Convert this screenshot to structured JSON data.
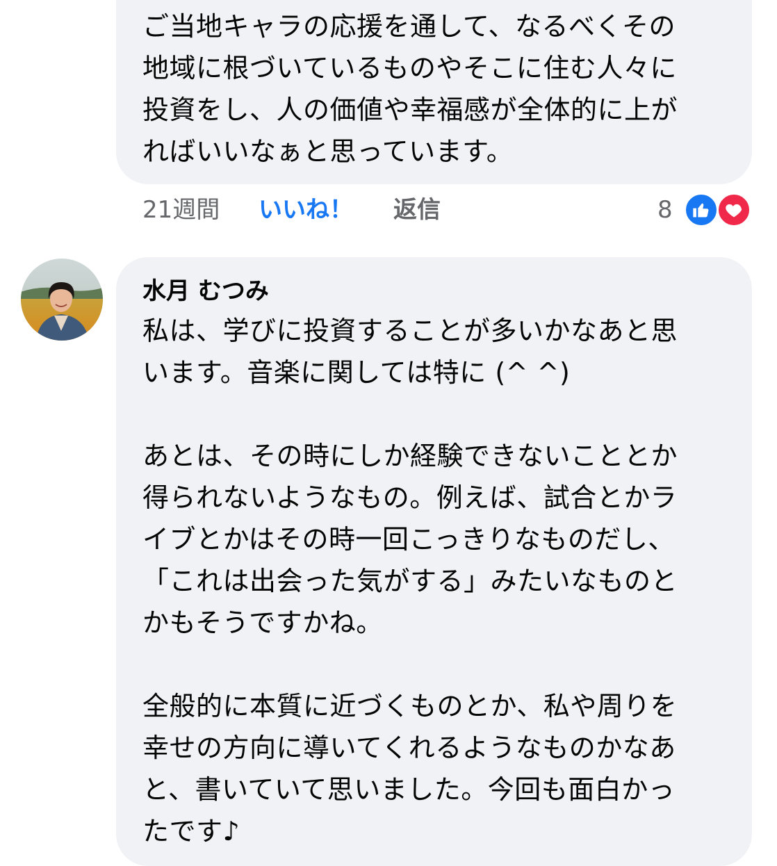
{
  "comments": [
    {
      "text": "ご当地キャラの応援を通して、なるべくその\n地域に根づいているものやそこに住む人々に\n投資をし、人の価値や幸福感が全体的に上が\nればいいなぁと思っています。",
      "time": "21週間",
      "like_label": "いいね！",
      "reply_label": "返信",
      "reaction_count": "8"
    },
    {
      "author": "水月 むつみ",
      "text": "私は、学びに投資することが多いかなあと思\nいます。音楽に関しては特に (^ ^)\n\nあとは、その時にしか経験できないこととか\n得られないようなもの。例えば、試合とかラ\nイブとかはその時一回こっきりなものだし、\n「これは出会った気がする」みたいなものと\nかもそうですかね。\n\n全般的に本質に近づくものとか、私や周りを\n幸せの方向に導いてくれるようなものかなあ\nと、書いていて思いました。今回も面白かっ\nたです♪"
    }
  ],
  "icons": {
    "like_reaction": "thumbs-up-icon",
    "love_reaction": "heart-icon"
  },
  "colors": {
    "bubble_bg": "#f0f2f5",
    "like_blue": "#1877f2",
    "love_red": "#f02849",
    "meta_gray": "#65676b"
  }
}
